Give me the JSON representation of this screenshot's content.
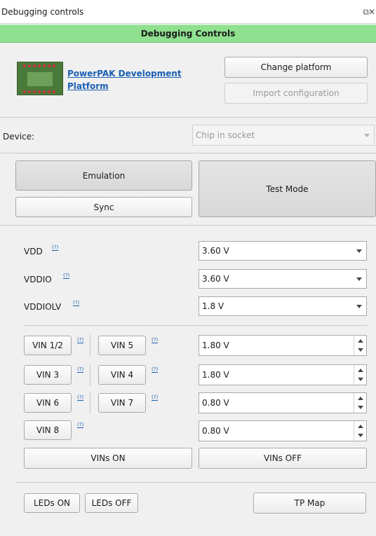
{
  "window": {
    "title": "Debugging controls",
    "controls": "⧉✕"
  },
  "banner": {
    "title": "Debugging Controls"
  },
  "platform": {
    "image_icon": "board-image",
    "name_line1": "PowerPAK Development",
    "name_line2": "Platform",
    "change_button": "Change platform",
    "import_button": "Import configuration"
  },
  "device": {
    "label": "Device:",
    "value": "Chip in socket"
  },
  "modes": {
    "emulation": "Emulation",
    "sync": "Sync",
    "test_mode": "Test Mode"
  },
  "supplies": [
    {
      "label": "VDD",
      "help": "(?)",
      "value": "3.60 V"
    },
    {
      "label": "VDDIO",
      "help": "(?)",
      "value": "3.60 V"
    },
    {
      "label": "VDDIOLV",
      "help": "(?)",
      "value": "1.8 V"
    }
  ],
  "vins": {
    "help": "(?)",
    "rows": [
      {
        "left": "VIN 1/2",
        "right": "VIN 5",
        "value": "1.80 V"
      },
      {
        "left": "VIN 3",
        "right": "VIN 4",
        "value": "1.80 V"
      },
      {
        "left": "VIN 6",
        "right": "VIN 7",
        "value": "0.80 V"
      },
      {
        "left": "VIN 8",
        "right": "",
        "value": "0.80 V"
      }
    ],
    "on_button": "VINs ON",
    "off_button": "VINs OFF"
  },
  "footer": {
    "leds_on": "LEDs ON",
    "leds_off": "LEDs OFF",
    "tp_map": "TP Map"
  }
}
